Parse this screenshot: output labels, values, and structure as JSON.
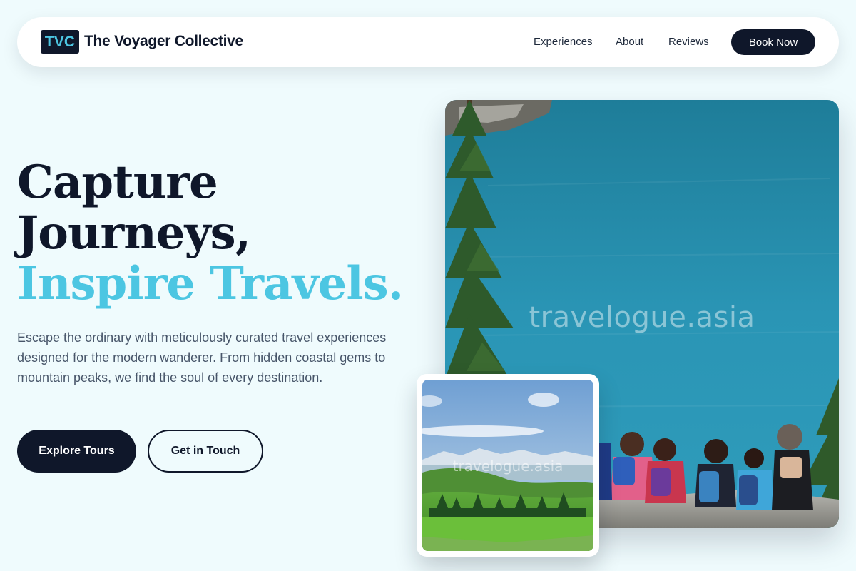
{
  "brand": {
    "logo_text": "TVC",
    "name": "The Voyager Collective"
  },
  "nav": {
    "links": [
      {
        "label": "Experiences"
      },
      {
        "label": "About"
      },
      {
        "label": "Reviews"
      }
    ],
    "cta_label": "Book Now"
  },
  "hero": {
    "headline_line1": "Capture",
    "headline_line2": "Journeys,",
    "headline_accent": "Inspire Travels.",
    "description": "Escape the ordinary with meticulously curated travel experiences designed for the modern wanderer. From hidden coastal gems to mountain peaks, we find the soul of every destination.",
    "primary_button": "Explore Tours",
    "secondary_button": "Get in Touch"
  },
  "images": {
    "main_watermark": "travelogue.asia",
    "secondary_watermark": "travelogue.asia"
  },
  "colors": {
    "background": "#effbfd",
    "navy": "#0f172a",
    "accent": "#4cc6e2",
    "body_text": "#475569"
  }
}
